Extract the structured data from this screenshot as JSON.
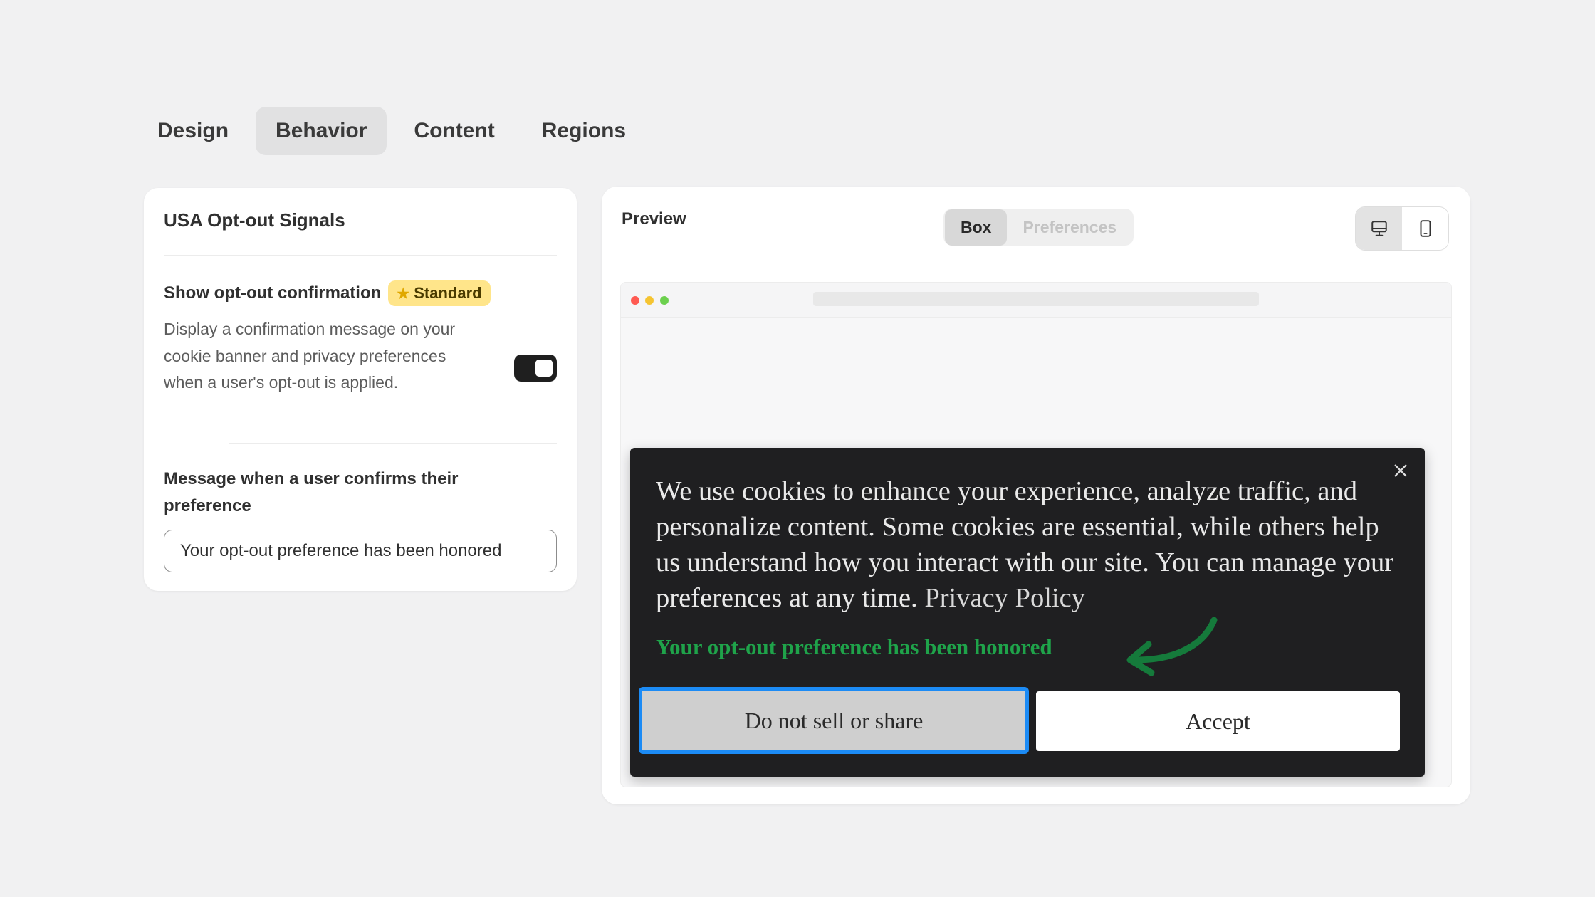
{
  "tabs": [
    {
      "label": "Design",
      "active": false
    },
    {
      "label": "Behavior",
      "active": true
    },
    {
      "label": "Content",
      "active": false
    },
    {
      "label": "Regions",
      "active": false
    }
  ],
  "left_card": {
    "title": "USA Opt-out Signals",
    "setting_label": "Show opt-out confirmation",
    "badge": {
      "icon": "star-icon",
      "label": "Standard"
    },
    "description": "Display a confirmation message on your cookie banner and privacy preferences when a user's opt-out is applied.",
    "toggle_on": true,
    "message_label": "Message when a user confirms their preference",
    "message_value": "Your opt-out preference has been honored"
  },
  "preview": {
    "title": "Preview",
    "segments": [
      {
        "label": "Box",
        "active": true
      },
      {
        "label": "Preferences",
        "active": false
      }
    ],
    "devices": [
      {
        "icon": "desktop-icon",
        "active": true
      },
      {
        "icon": "mobile-icon",
        "active": false
      }
    ],
    "banner": {
      "text": "We use cookies to enhance your experience, analyze traffic, and personalize content. Some cookies are essential, while others help us understand how you interact with our site. You can manage your preferences at any time.",
      "policy_link": "Privacy Policy",
      "confirmation": "Your opt-out preference has been honored",
      "do_not_sell_label": "Do not sell or share",
      "accept_label": "Accept"
    }
  },
  "colors": {
    "confirmation_green": "#1fa34a",
    "focus_blue": "#1c8bf5",
    "badge_yellow": "#ffe58a",
    "banner_bg": "#1f1f21"
  }
}
